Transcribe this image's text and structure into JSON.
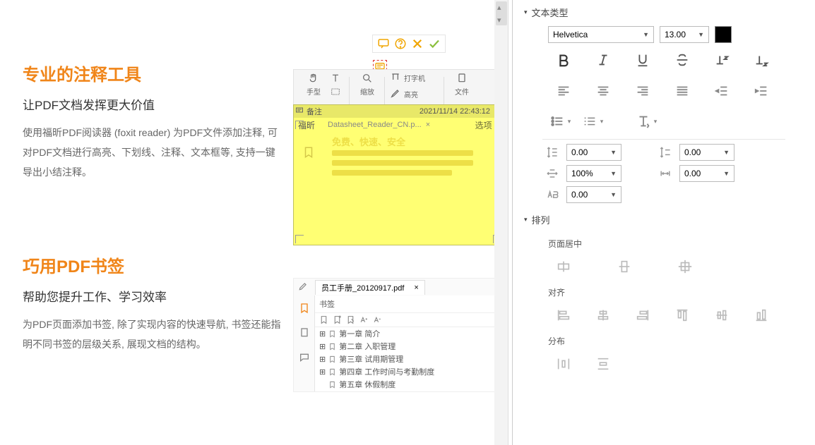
{
  "left": {
    "section1": {
      "title": "专业的注释工具",
      "subtitle": "让PDF文档发挥更大价值",
      "body": "使用福昕PDF阅读器 (foxit reader) 为PDF文件添加注释, 可对PDF文档进行高亮、下划线、注释、文本框等, 支持一键导出小结注释。"
    },
    "section2": {
      "title": "巧用PDF书签",
      "subtitle": "帮助您提升工作、学习效率",
      "body": "为PDF页面添加书签, 除了实现内容的快速导航, 书签还能指明不同书签的层级关系, 展现文档的结构。"
    }
  },
  "fig1": {
    "toolbar_labels": {
      "hand": "手型",
      "zoom": "缩放",
      "typewriter": "打字机",
      "highlight": "高亮",
      "attach": "文件"
    },
    "note": {
      "title": "备注",
      "timestamp": "2021/11/14 22:43:12",
      "author": "福昕",
      "tab_name": "Datasheet_Reader_CN.p...",
      "options_label": "选项",
      "ghost_title": "免费、快速、安全"
    }
  },
  "fig2": {
    "doc_tab": "员工手册_20120917.pdf",
    "panel_title": "书签",
    "bookmarks": [
      "第一章  简介",
      "第二章  入职管理",
      "第三章  试用期管理",
      "第四章  工作时间与考勤制度",
      "第五章  休假制度"
    ]
  },
  "rpanel": {
    "section_text_type": "文本类型",
    "font_name": "Helvetica",
    "font_size": "13.00",
    "spacing_topleft": "0.00",
    "spacing_topright": "0.00",
    "spacing_scale": "100%",
    "spacing_botright": "0.00",
    "spacing_char": "0.00",
    "section_arrange": "排列",
    "sub_page_center": "页面居中",
    "sub_align": "对齐",
    "sub_distribute": "分布"
  }
}
